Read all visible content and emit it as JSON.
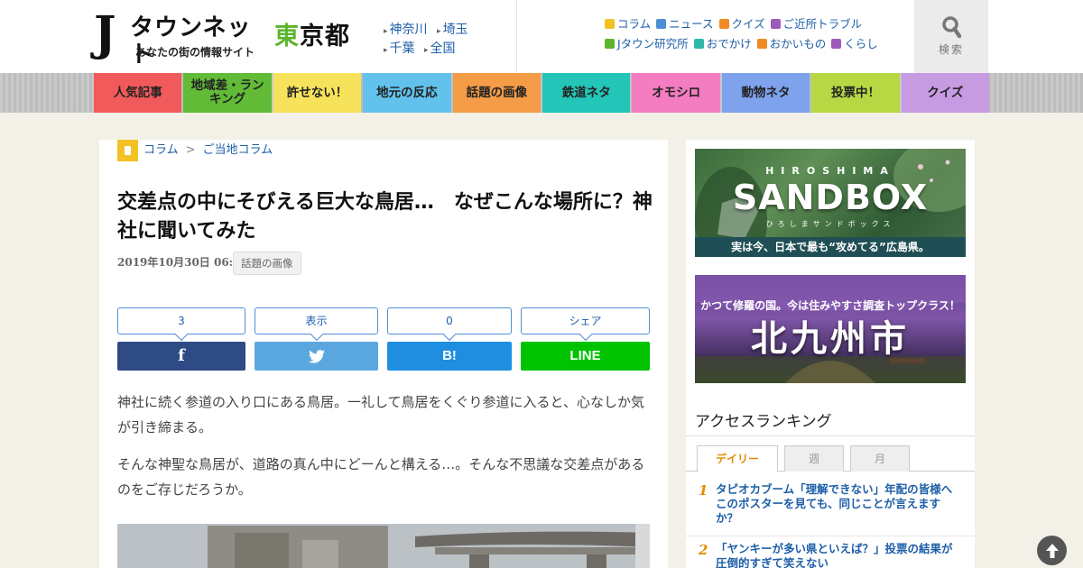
{
  "header": {
    "logo": {
      "mark": "J",
      "main": "タウンネット",
      "sub": "あなたの街の情報サイト"
    },
    "region": {
      "first": "東",
      "rest": "京都"
    },
    "region_links": [
      "神奈川",
      "埼玉",
      "千葉",
      "全国"
    ],
    "quick_links": [
      {
        "label": "コラム",
        "color": "#f2c224"
      },
      {
        "label": "ニュース",
        "color": "#4d8ed6"
      },
      {
        "label": "クイズ",
        "color": "#f08a24"
      },
      {
        "label": "ご近所トラブル",
        "color": "#9c5bb8"
      },
      {
        "label": "Jタウン研究所",
        "color": "#5db52d"
      },
      {
        "label": "おでかけ",
        "color": "#2fb8a8"
      },
      {
        "label": "おかいもの",
        "color": "#f08a24"
      },
      {
        "label": "くらし",
        "color": "#9c5bb8"
      }
    ],
    "search_label": "検索",
    "search_icon": "search-icon"
  },
  "nav": [
    {
      "label": "人気記事",
      "color": "#f15a5a"
    },
    {
      "label": "地域差・ランキング",
      "color": "#62bb37"
    },
    {
      "label": "許せない！",
      "color": "#f7e35b"
    },
    {
      "label": "地元の反応",
      "color": "#62c2ec"
    },
    {
      "label": "話題の画像",
      "color": "#f59c48"
    },
    {
      "label": "鉄道ネタ",
      "color": "#22c5b7"
    },
    {
      "label": "オモシロ",
      "color": "#f47cc0"
    },
    {
      "label": "動物ネタ",
      "color": "#7ea2ec"
    },
    {
      "label": "投票中！",
      "color": "#b8d843"
    },
    {
      "label": "クイズ",
      "color": "#c69be2"
    }
  ],
  "article": {
    "breadcrumb": [
      "コラム",
      "ご当地コラム"
    ],
    "breadcrumb_sep": ">",
    "title": "交差点の中にそびえる巨大な鳥居…　なぜこんな場所に？神社に聞いてみた",
    "date": "2019年10月30日 06:00",
    "category": "話題の画像",
    "share": {
      "facebook_count": "3",
      "twitter_count": "表示",
      "hatena_count": "0",
      "line_count": "シェア",
      "facebook_label": "f",
      "hatena_label": "B!",
      "line_label": "LINE",
      "colors": {
        "facebook": "#2f4b86",
        "twitter": "#5aa7e0",
        "hatena": "#1f8ee0",
        "line": "#00c300"
      }
    },
    "paragraphs": [
      "神社に続く参道の入り口にある鳥居。一礼して鳥居をくぐり参道に入ると、心なしか気が引き締まる。",
      "そんな神聖な鳥居が、道路の真ん中にどーんと構える…。そんな不思議な交差点があるのをご存じだろうか。"
    ]
  },
  "sidebar": {
    "banner_hiroshima": {
      "top": "HIROSHIMA",
      "main": "SANDBOX",
      "kana": "ひろしまサンドボックス",
      "caption": "実は今、日本で最も“攻めてる”広島県。"
    },
    "banner_kitakyushu": {
      "top": "かつて修羅の国。今は住みやすさ調査トップクラス！",
      "main": "北九州市"
    },
    "ranking": {
      "title": "アクセスランキング",
      "tabs": [
        "デイリー",
        "週",
        "月"
      ],
      "active_tab": "デイリー",
      "items": [
        {
          "rank": "1",
          "text": "タピオカブーム「理解できない」年配の皆様へ　このポスターを見ても、同じことが言えますか？"
        },
        {
          "rank": "2",
          "text": "「ヤンキーが多い県といえば？」投票の結果が圧倒的すぎて笑えない"
        }
      ]
    }
  }
}
